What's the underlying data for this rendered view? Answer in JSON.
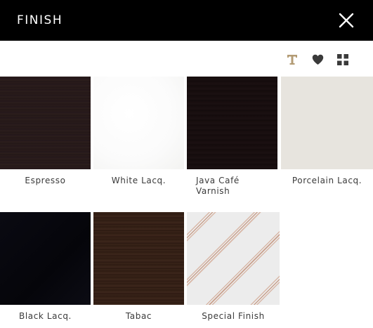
{
  "header": {
    "title": "FINISH",
    "close_icon": "close-icon"
  },
  "toolbar": {
    "icons": [
      "text-icon",
      "heart-icon",
      "grid-icon"
    ],
    "accent_color": "#b39b74"
  },
  "swatches": [
    {
      "label": "Espresso",
      "color": "#261a19"
    },
    {
      "label": "White Lacq.",
      "color": "#fafaf9"
    },
    {
      "label": "Java Café Varnish",
      "color": "#170e0f"
    },
    {
      "label": "Porcelain Lacq.",
      "color": "#e7e4de"
    },
    {
      "label": "Black Lacq.",
      "color": "#07070d"
    },
    {
      "label": "Tabac",
      "color": "#35201a"
    },
    {
      "label": "Special Finish",
      "color": "#ececec"
    }
  ]
}
